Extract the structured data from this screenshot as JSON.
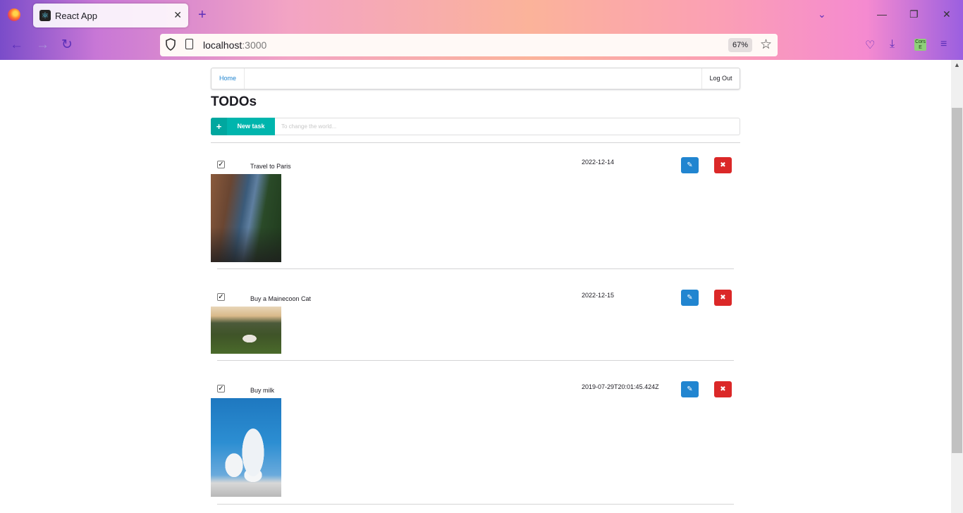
{
  "browser": {
    "tab_title": "React App",
    "url_host": "localhost",
    "url_port": ":3000",
    "zoom": "67%",
    "cors_ext": "Cors E"
  },
  "menu": {
    "home": "Home",
    "logout": "Log Out"
  },
  "page": {
    "title": "TODOs",
    "new_task_label": "New task",
    "new_task_placeholder": "To change the world..."
  },
  "todos": [
    {
      "name": "Travel to Paris",
      "date": "2022-12-14",
      "done": true,
      "photo": "paris-street"
    },
    {
      "name": "Buy a Mainecoon Cat",
      "date": "2022-12-15",
      "done": true,
      "photo": "cat-in-grass"
    },
    {
      "name": "Buy milk",
      "date": "2019-07-29T20:01:45.424Z",
      "done": true,
      "photo": "milk-bottles"
    }
  ],
  "colors": {
    "teal": "#00b5ad",
    "blue": "#2185d0",
    "red": "#db2828"
  }
}
